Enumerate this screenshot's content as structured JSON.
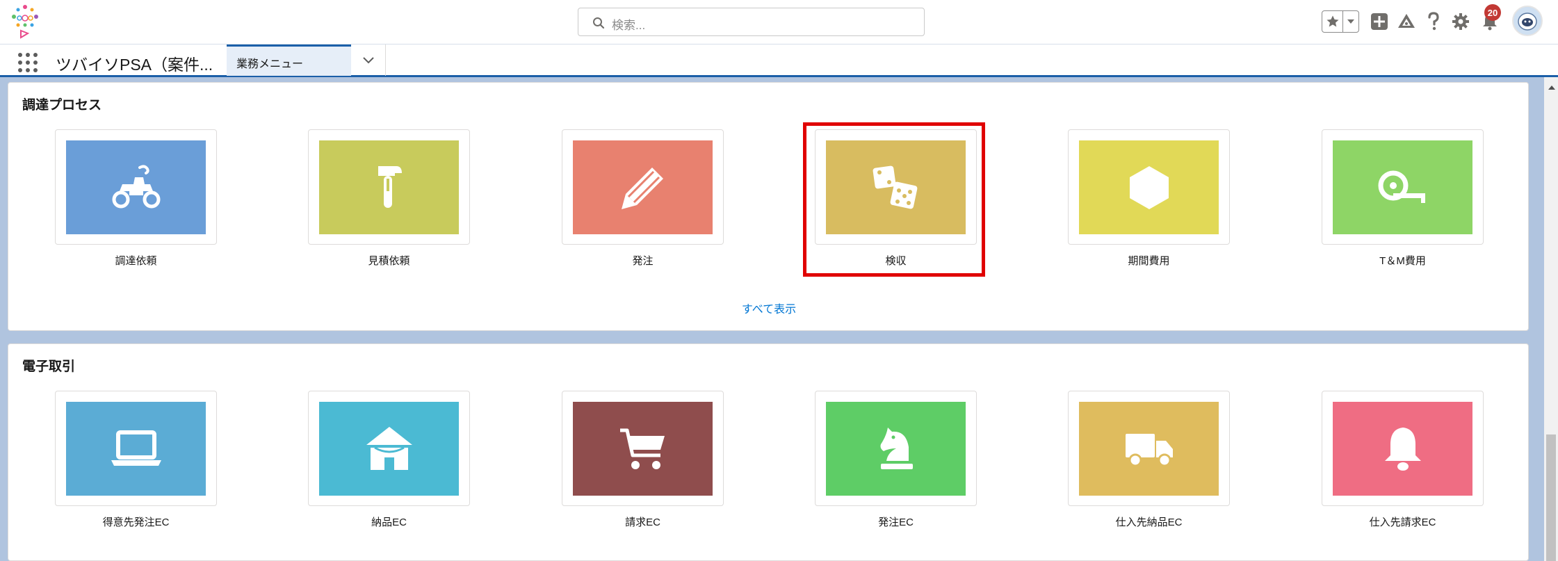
{
  "header": {
    "search_placeholder": "検索...",
    "notification_count": "20"
  },
  "navbar": {
    "app_name": "ツバイソPSA（案件...",
    "active_tab": "業務メニュー"
  },
  "sections": [
    {
      "title": "調達プロセス",
      "show_all": "すべて表示",
      "tiles": [
        {
          "label": "調達依頼",
          "icon": "atv-icon",
          "color": "#6a9ed8"
        },
        {
          "label": "見積依頼",
          "icon": "hammer-icon",
          "color": "#c8cb5c"
        },
        {
          "label": "発注",
          "icon": "pencil-icon",
          "color": "#e8816f"
        },
        {
          "label": "検収",
          "icon": "dice-icon",
          "color": "#d8bc60"
        },
        {
          "label": "期間費用",
          "icon": "hexagon-icon",
          "color": "#e1d957"
        },
        {
          "label": "T＆M費用",
          "icon": "tape-measure-icon",
          "color": "#8ed566"
        }
      ]
    },
    {
      "title": "電子取引",
      "tiles": [
        {
          "label": "得意先発注EC",
          "icon": "laptop-icon",
          "color": "#5bacd5"
        },
        {
          "label": "納品EC",
          "icon": "hut-icon",
          "color": "#4bbad3"
        },
        {
          "label": "請求EC",
          "icon": "cart-icon",
          "color": "#8f4d4d"
        },
        {
          "label": "発注EC",
          "icon": "chess-knight-icon",
          "color": "#5ecd66"
        },
        {
          "label": "仕入先納品EC",
          "icon": "truck-icon",
          "color": "#dfbc5e"
        },
        {
          "label": "仕入先請求EC",
          "icon": "bell-icon",
          "color": "#ef6d83"
        }
      ]
    }
  ],
  "colors": {
    "brand": "#1b5fa8",
    "link": "#0176d3",
    "highlight": "#e00000",
    "badge": "#c23934"
  }
}
